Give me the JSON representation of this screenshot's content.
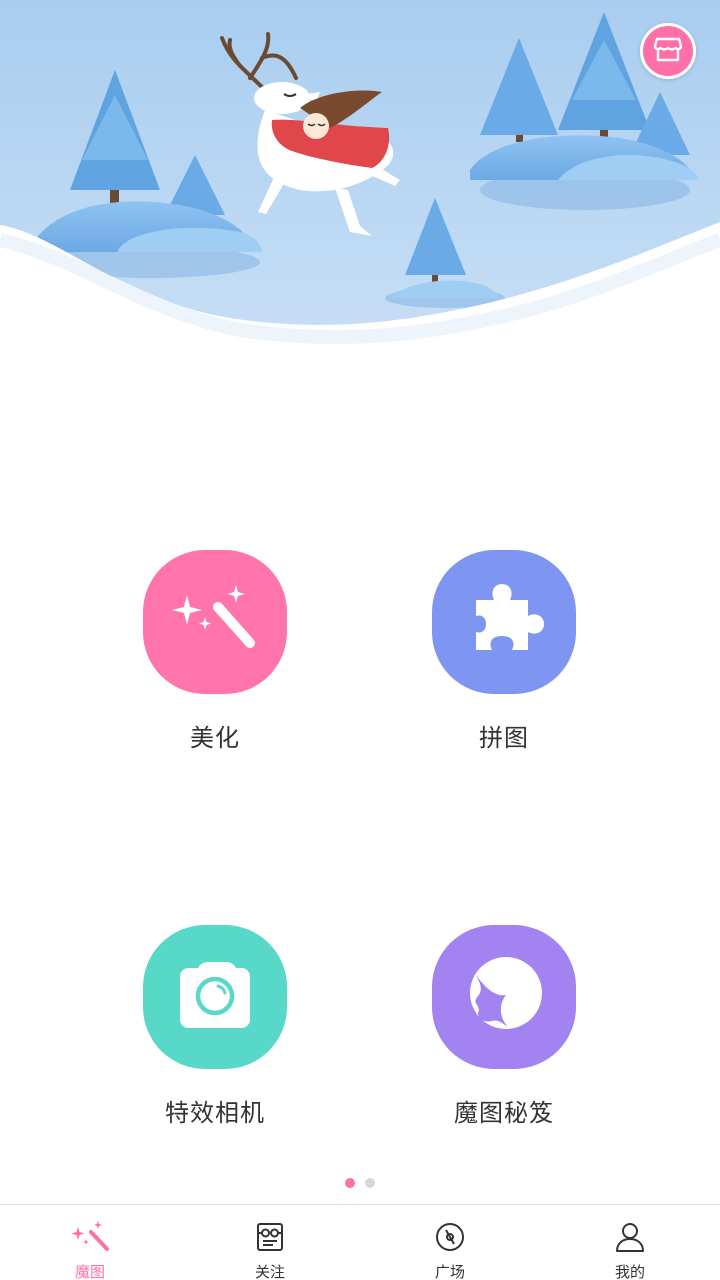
{
  "colors": {
    "accent": "#ff6fa8",
    "beautify": "#ff74ab",
    "collage": "#7e96f2",
    "camera": "#58d8c8",
    "tips": "#a382f2",
    "inactive_dot": "#d7d7d7"
  },
  "header": {
    "store_icon": "store-icon"
  },
  "features": [
    {
      "label": "美化",
      "icon": "magic-wand-sparkle-icon"
    },
    {
      "label": "拼图",
      "icon": "puzzle-piece-icon"
    },
    {
      "label": "特效相机",
      "icon": "camera-icon"
    },
    {
      "label": "魔图秘笈",
      "icon": "face-profile-icon"
    }
  ],
  "pager": {
    "current": 1,
    "total": 2
  },
  "tabs": [
    {
      "label": "魔图",
      "icon": "magic-wand-icon",
      "active": true
    },
    {
      "label": "关注",
      "icon": "follow-icon",
      "active": false
    },
    {
      "label": "广场",
      "icon": "compass-icon",
      "active": false
    },
    {
      "label": "我的",
      "icon": "profile-icon",
      "active": false
    }
  ]
}
